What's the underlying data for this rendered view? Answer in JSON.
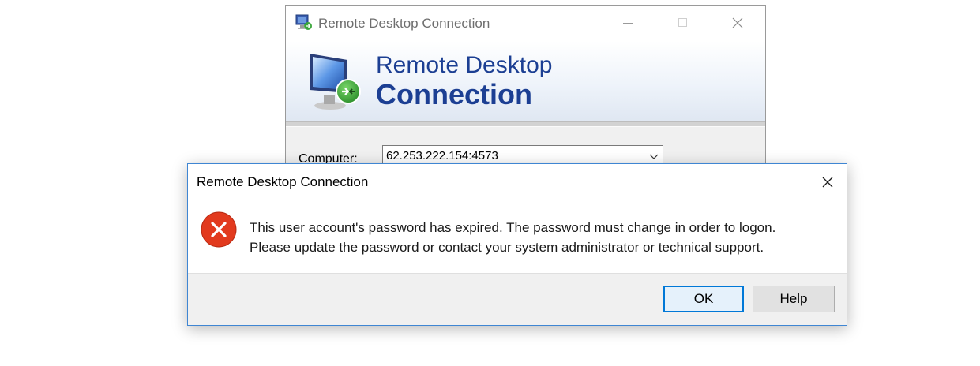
{
  "main_window": {
    "title": "Remote Desktop Connection",
    "banner": {
      "line1": "Remote Desktop",
      "line2": "Connection"
    },
    "computer_label": "Computer:",
    "computer_value": "62.253.222.154:4573"
  },
  "dialog": {
    "title": "Remote Desktop Connection",
    "icon": "error-icon",
    "message_line1": "This user account's password has expired. The password must change in order to logon.",
    "message_line2": "Please update the password or contact your system administrator or technical support.",
    "buttons": {
      "ok": "OK",
      "help_first_letter": "H",
      "help_rest": "elp"
    }
  },
  "colors": {
    "banner_text": "#1c3f93",
    "dialog_border": "#3f86d3",
    "error_red": "#e23a1e",
    "default_button_border": "#0078d7"
  }
}
